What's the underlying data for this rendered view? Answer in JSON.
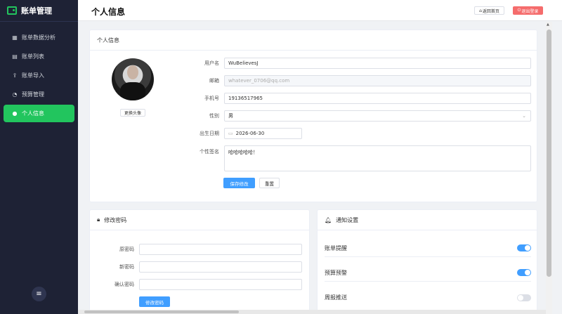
{
  "brand": {
    "title": "账单管理"
  },
  "sidebar": {
    "items": [
      {
        "label": "账单数据分析",
        "icon": "chart-icon",
        "glyph": "▦"
      },
      {
        "label": "账单列表",
        "icon": "list-icon",
        "glyph": "▤"
      },
      {
        "label": "账单导入",
        "icon": "upload-icon",
        "glyph": "⇪"
      },
      {
        "label": "预算管理",
        "icon": "pie-icon",
        "glyph": "◔"
      },
      {
        "label": "个人信息",
        "icon": "user-icon",
        "glyph": "👤",
        "active": true
      }
    ],
    "menu_glyph": "≡"
  },
  "header": {
    "title": "个人信息",
    "home_label": "返回首页",
    "logout_label": "退出登录"
  },
  "profile": {
    "card_title": "个人信息",
    "change_avatar": "更换头像",
    "fields": {
      "username_label": "用户名",
      "username_value": "WuBelievesJ",
      "email_label": "邮箱",
      "email_value": "whatever_0706@qq.com",
      "phone_label": "手机号",
      "phone_value": "19136517965",
      "gender_label": "性别",
      "gender_value": "男",
      "birthday_label": "出生日期",
      "birthday_value": "2026-06-30",
      "signature_label": "个性签名",
      "signature_value": "哈哈哈哈哈！"
    },
    "save_label": "保存修改",
    "reset_label": "重置"
  },
  "password": {
    "card_title": "修改密码",
    "old_label": "原密码",
    "new_label": "新密码",
    "confirm_label": "确认密码",
    "submit_label": "修改密码"
  },
  "notifications": {
    "card_title": "通知设置",
    "items": [
      {
        "label": "账单提醒",
        "enabled": true
      },
      {
        "label": "预算预警",
        "enabled": true
      },
      {
        "label": "周报推送",
        "enabled": false
      }
    ]
  },
  "colors": {
    "accent": "#22c55e",
    "primary": "#409eff",
    "danger": "#f56c6c",
    "sidebar_bg": "#1e2235"
  }
}
